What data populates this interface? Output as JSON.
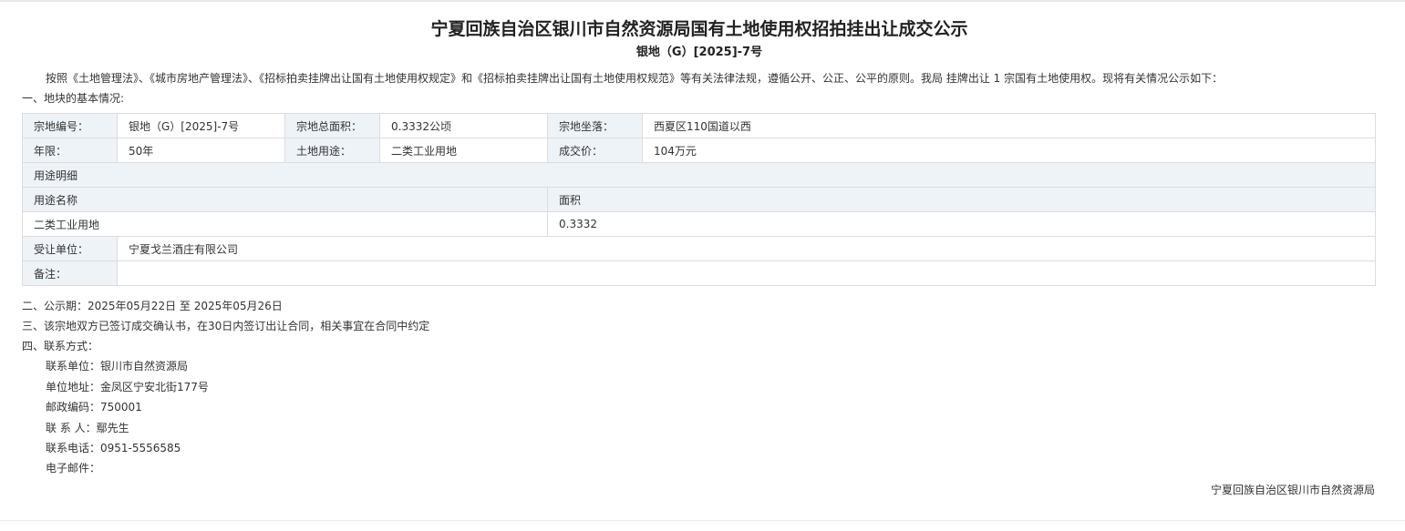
{
  "notice": {
    "title": "宁夏回族自治区银川市自然资源局国有土地使用权招拍挂出让成交公示",
    "number": "银地（G）[2025]-7号",
    "intro": "按照《土地管理法》、《城市房地产管理法》、《招标拍卖挂牌出让国有土地使用权规定》和《招标拍卖挂牌出让国有土地使用权规范》等有关法律法规，遵循公开、公正、公平的原则。我局 挂牌出让 1 宗国有土地使用权。现将有关情况公示如下：",
    "section1": "一、地块的基本情况:"
  },
  "table": {
    "parcel_no_label": "宗地编号：",
    "parcel_no": "银地（G）[2025]-7号",
    "area_label": "宗地总面积：",
    "area": "0.3332公顷",
    "location_label": "宗地坐落：",
    "location": "西夏区110国道以西",
    "term_label": "年限：",
    "term": "50年",
    "use_label": "土地用途：",
    "use": "二类工业用地",
    "price_label": "成交价：",
    "price": "104万元",
    "use_detail_label": "用途明细",
    "use_name_header": "用途名称",
    "use_area_header": "面积",
    "use_name": "二类工业用地",
    "use_area": "0.3332",
    "buyer_label": "受让单位：",
    "buyer": "宁夏戈兰酒庄有限公司",
    "remark_label": "备注：",
    "remark": ""
  },
  "sections": {
    "period": "二、公示期：2025年05月22日 至 2025年05月26日",
    "contract": "三、该宗地双方已签订成交确认书，在30日内签订出让合同，相关事宜在合同中约定",
    "contact_title": "四、联系方式："
  },
  "contact": {
    "unit": "联系单位：银川市自然资源局",
    "address": "单位地址：金凤区宁安北街177号",
    "postcode": "邮政编码：750001",
    "person": "联 系 人：鄢先生",
    "phone": "联系电话：0951-5556585",
    "email": "电子邮件："
  },
  "footer": {
    "org": "宁夏回族自治区银川市自然资源局"
  }
}
